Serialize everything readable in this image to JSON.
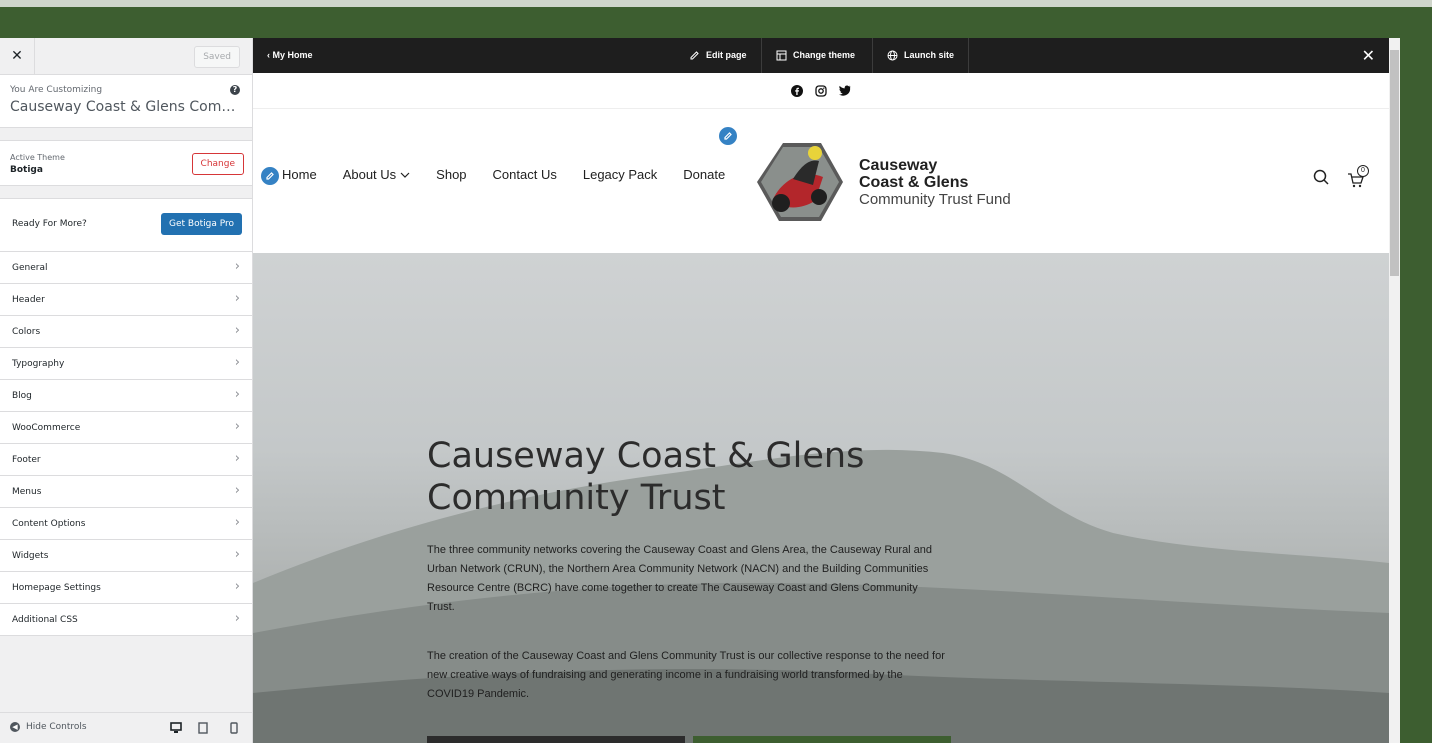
{
  "sidebar": {
    "saved_label": "Saved",
    "customizing_label": "You Are Customizing",
    "site_title": "Causeway Coast & Glens Communit...",
    "active_theme_label": "Active Theme",
    "active_theme_name": "Botiga",
    "change_label": "Change",
    "ready_label": "Ready For More?",
    "get_pro_label": "Get Botiga Pro",
    "items": [
      {
        "label": "General"
      },
      {
        "label": "Header"
      },
      {
        "label": "Colors"
      },
      {
        "label": "Typography"
      },
      {
        "label": "Blog"
      },
      {
        "label": "WooCommerce"
      },
      {
        "label": "Footer"
      },
      {
        "label": "Menus"
      },
      {
        "label": "Content Options"
      },
      {
        "label": "Widgets"
      },
      {
        "label": "Homepage Settings"
      },
      {
        "label": "Additional CSS"
      }
    ],
    "hide_controls_label": "Hide Controls"
  },
  "topbar": {
    "back_label": "My Home",
    "edit_page_label": "Edit page",
    "change_theme_label": "Change theme",
    "launch_site_label": "Launch site"
  },
  "header": {
    "nav": [
      "Home",
      "About Us",
      "Shop",
      "Contact Us",
      "Legacy Pack",
      "Donate"
    ],
    "brand_line1": "Causeway",
    "brand_line2": "Coast & Glens",
    "brand_line3": "Community Trust Fund",
    "cart_count": "0"
  },
  "hero": {
    "title_line1": "Causeway Coast & Glens",
    "title_line2": "Community Trust",
    "paragraph1": "The three community networks covering the Causeway Coast and Glens Area, the Causeway Rural and Urban Network (CRUN), the Northern Area Community Network (NACN) and the Building Communities Resource Centre (BCRC) have come together to create The Causeway Coast and Glens Community Trust.",
    "paragraph2": "The creation of the Causeway Coast and Glens Community Trust is our collective response to the need for new creative ways of fundraising and generating income in a fundraising world transformed by the COVID19 Pandemic."
  },
  "colors": {
    "frame_green": "#3d5e30",
    "wp_blue": "#2271b1",
    "change_red": "#d63638"
  }
}
